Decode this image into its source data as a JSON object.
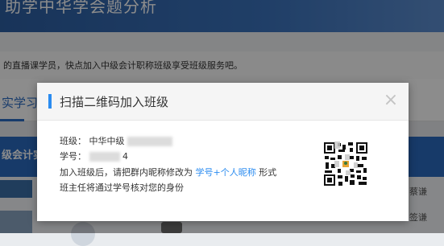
{
  "background": {
    "banner_title": "助学中华学会题分析",
    "notice_text": "的直播课学员，快点加入中级会计职称班级享受班级服务吧。",
    "tab_label": "实学习",
    "course_title": "级会计实务",
    "side_item_1": "蔡谦",
    "side_item_2": "签谦"
  },
  "modal": {
    "title": "扫描二维码加入班级",
    "close_symbol": "×",
    "class_label": "班级：",
    "class_value": "中华中级",
    "student_id_label": "学号：",
    "student_id_value": "4",
    "instruction_prefix": "加入班级后，请把群内昵称修改为",
    "instruction_link": "学号+个人昵称",
    "instruction_suffix": "形式",
    "instruction_line2": "班主任将通过学号核对您的身份"
  },
  "colors": {
    "accent": "#2b8cf0",
    "banner": "#2d5fa3"
  },
  "icons": {
    "close": "close-icon",
    "qr": "qr-code-icon"
  }
}
